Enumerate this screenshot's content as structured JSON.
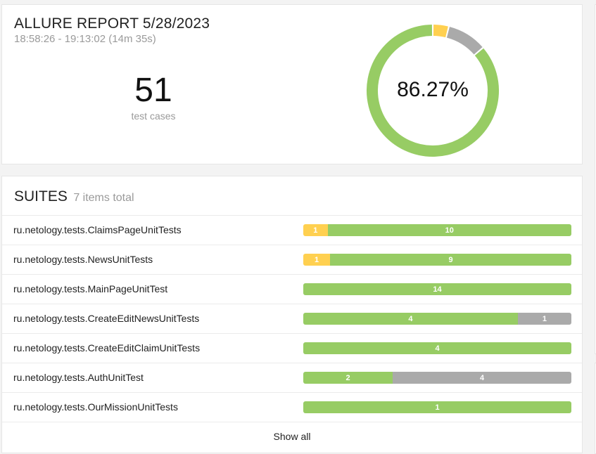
{
  "report": {
    "title": "ALLURE REPORT 5/28/2023",
    "time": "18:58:26 - 19:13:02 (14m 35s)",
    "count": "51",
    "count_label": "test cases",
    "percent": "86.27%",
    "stats": {
      "passed": 44,
      "broken": 2,
      "skipped": 5,
      "total": 51
    }
  },
  "colors": {
    "passed": "#97cc64",
    "broken": "#ffd050",
    "skipped": "#aaaaaa"
  },
  "suites": {
    "title": "SUITES",
    "total": "7 items total",
    "show_all": "Show all",
    "items": [
      {
        "name": "ru.netology.tests.ClaimsPageUnitTests",
        "segments": [
          {
            "status": "broken",
            "count": 1
          },
          {
            "status": "passed",
            "count": 10
          }
        ]
      },
      {
        "name": "ru.netology.tests.NewsUnitTests",
        "segments": [
          {
            "status": "broken",
            "count": 1
          },
          {
            "status": "passed",
            "count": 9
          }
        ]
      },
      {
        "name": "ru.netology.tests.MainPageUnitTest",
        "segments": [
          {
            "status": "passed",
            "count": 14
          }
        ]
      },
      {
        "name": "ru.netology.tests.CreateEditNewsUnitTests",
        "segments": [
          {
            "status": "passed",
            "count": 4
          },
          {
            "status": "skipped",
            "count": 1
          }
        ]
      },
      {
        "name": "ru.netology.tests.CreateEditClaimUnitTests",
        "segments": [
          {
            "status": "passed",
            "count": 4
          }
        ]
      },
      {
        "name": "ru.netology.tests.AuthUnitTest",
        "segments": [
          {
            "status": "passed",
            "count": 2
          },
          {
            "status": "skipped",
            "count": 4
          }
        ]
      },
      {
        "name": "ru.netology.tests.OurMissionUnitTests",
        "segments": [
          {
            "status": "passed",
            "count": 1
          }
        ]
      }
    ]
  }
}
